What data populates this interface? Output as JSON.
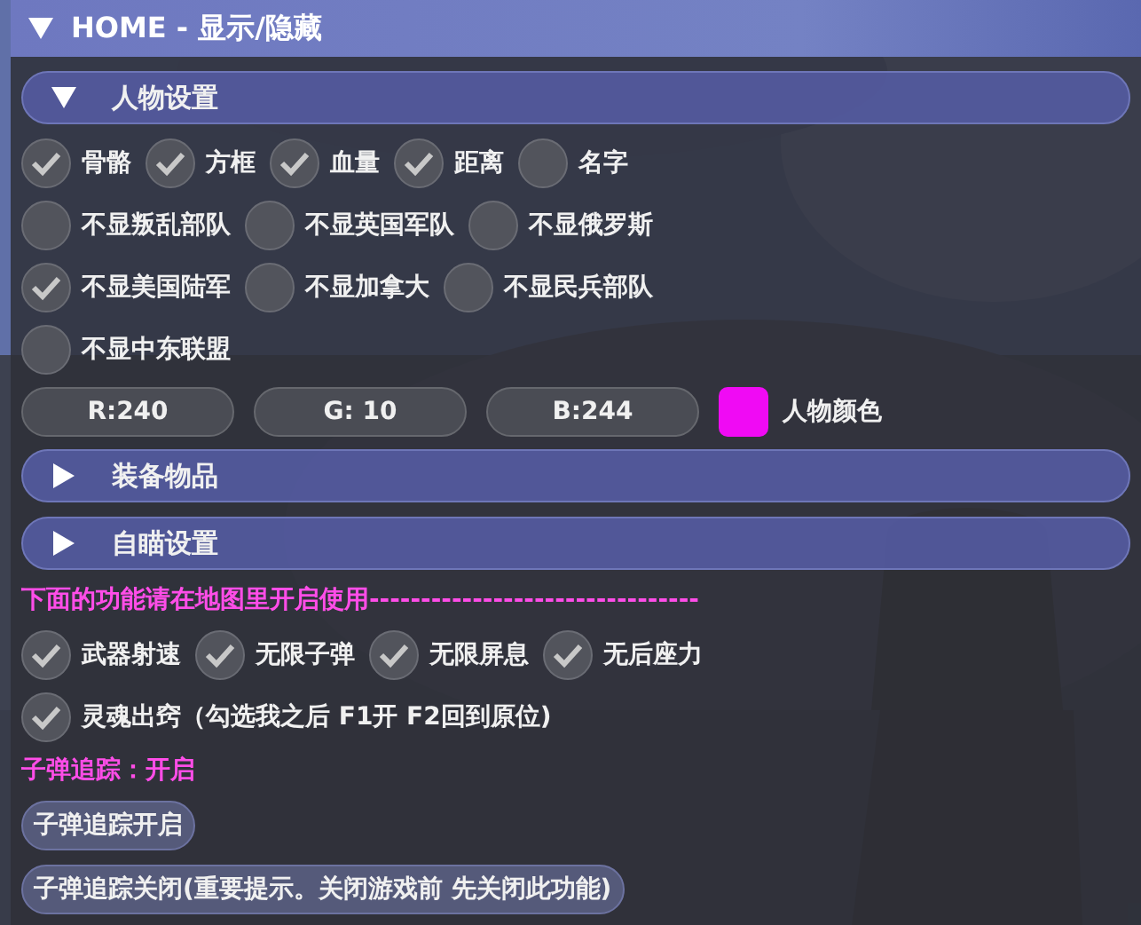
{
  "window": {
    "title": "HOME - 显示/隐藏",
    "expanded": true
  },
  "sections": [
    {
      "label": "人物设置",
      "expanded": true,
      "lines": [
        {
          "checkboxes": [
            {
              "label": "骨骼",
              "checked": true
            },
            {
              "label": "方框",
              "checked": true
            },
            {
              "label": "血量",
              "checked": true
            },
            {
              "label": "距离",
              "checked": true
            },
            {
              "label": "名字",
              "checked": false
            }
          ]
        },
        {
          "checkboxes": [
            {
              "label": "不显叛乱部队",
              "checked": false
            },
            {
              "label": "不显英国军队",
              "checked": false
            },
            {
              "label": "不显俄罗斯",
              "checked": false
            }
          ]
        },
        {
          "checkboxes": [
            {
              "label": "不显美国陆军",
              "checked": true
            },
            {
              "label": "不显加拿大",
              "checked": false
            },
            {
              "label": "不显民兵部队",
              "checked": false
            }
          ]
        },
        {
          "checkboxes": [
            {
              "label": "不显中东联盟",
              "checked": false
            }
          ]
        }
      ],
      "color_fields": [
        "R:240",
        "G: 10",
        "B:244"
      ],
      "swatch": {
        "color": "#f00af4",
        "label": "人物颜色"
      }
    },
    {
      "label": "装备物品",
      "expanded": false
    },
    {
      "label": "自瞄设置",
      "expanded": false
    }
  ],
  "notice": "下面的功能请在地图里开启使用--------------------------------",
  "option_lines": [
    {
      "checkboxes": [
        {
          "label": "武器射速",
          "checked": true
        },
        {
          "label": "无限子弹",
          "checked": true
        },
        {
          "label": "无限屏息",
          "checked": true
        },
        {
          "label": "无后座力",
          "checked": true
        }
      ]
    },
    {
      "checkboxes": [
        {
          "label": "灵魂出窍（勾选我之后 F1开 F2回到原位)",
          "checked": true
        }
      ]
    }
  ],
  "status": "子弹追踪：开启",
  "buttons": [
    "子弹追踪开启",
    "子弹追踪关闭(重要提示。关闭游戏前 先关闭此功能)"
  ]
}
